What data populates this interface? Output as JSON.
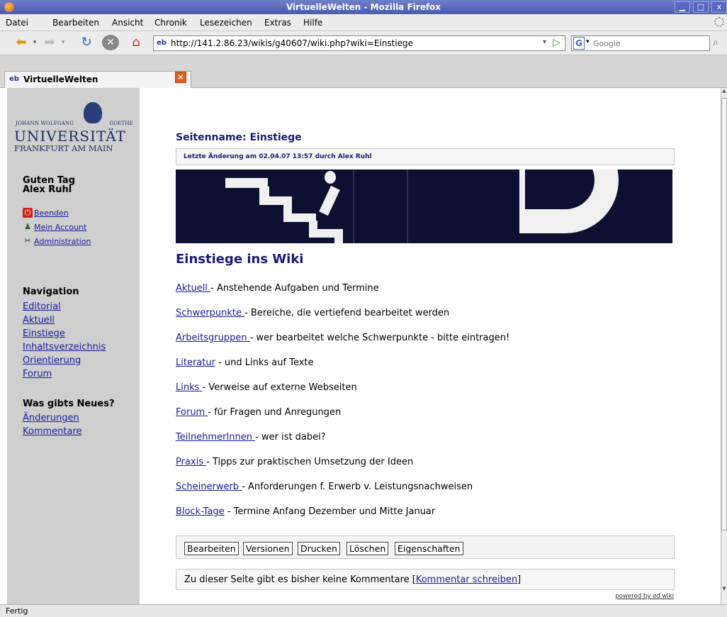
{
  "window": {
    "title": "VirtuelleWelten - Mozilla Firefox"
  },
  "menu": [
    "Datei",
    "Bearbeiten",
    "Ansicht",
    "Chronik",
    "Lesezeichen",
    "Extras",
    "Hilfe"
  ],
  "toolbar": {
    "url": "http://141.2.86.23/wikis/g40607/wiki.php?wiki=Einstiege",
    "search_placeholder": "Google"
  },
  "tab": {
    "label": "VirtuelleWelten",
    "favicon": "eb"
  },
  "logo": {
    "line1_left": "JOHANN WOLFGANG",
    "line1_right": "GOETHE",
    "line2": "UNIVERSITÄT",
    "line3": "FRANKFURT AM MAIN"
  },
  "sidebar": {
    "greeting_line1": "Guten Tag",
    "greeting_line2": "Alex Ruhl",
    "user_links": [
      {
        "label": "Beenden",
        "icon": "power-icon"
      },
      {
        "label": "Mein Account",
        "icon": "user-icon"
      },
      {
        "label": "Administration",
        "icon": "tools-icon"
      }
    ],
    "nav_heading": "Navigation",
    "nav_items": [
      "Editorial",
      "Aktuell",
      "Einstiege",
      "Inhaltsverzeichnis",
      "Orientierung",
      "Forum"
    ],
    "news_heading": "Was gibts Neues?",
    "news_items": [
      "Änderungen",
      "Kommentare"
    ]
  },
  "main": {
    "page_name": "Seitenname: Einstiege",
    "last_modified": "Letzte Änderung am 02.04.07 13:57 durch Alex Ruhl",
    "heading": "Einstiege ins Wiki",
    "entries": [
      {
        "link": "Aktuell ",
        "text": "- Anstehende Aufgaben und Termine"
      },
      {
        "link": "Schwerpunkte ",
        "text": "- Bereiche, die vertiefend bearbeitet werden"
      },
      {
        "link": "Arbeitsgruppen ",
        "text": "- wer bearbeitet welche Schwerpunkte - bitte eintragen!"
      },
      {
        "link": "Literatur",
        "text": " - und Links auf Texte"
      },
      {
        "link": "Links ",
        "text": "- Verweise auf externe Webseiten"
      },
      {
        "link": "Forum ",
        "text": "- für Fragen und Anregungen"
      },
      {
        "link": "TeilnehmerInnen ",
        "text": "- wer ist dabei?"
      },
      {
        "link": "Praxis ",
        "text": "- Tipps zur praktischen Umsetzung der Ideen"
      },
      {
        "link": "Scheinerwerb ",
        "text": "- Anforderungen f. Erwerb v. Leistungsnachweisen"
      },
      {
        "link": "Block-Tage",
        "text": " - Termine Anfang Dezember und Mitte Januar"
      }
    ],
    "actions": [
      "Bearbeiten",
      "Versionen",
      "Drucken",
      "Löschen",
      "Eigenschaften"
    ],
    "comment_prefix": "Zu dieser Seite gibt es bisher keine Kommentare [",
    "comment_link": "Kommentar schreiben",
    "comment_suffix": "]",
    "powered_by": "powered by ed.wiki"
  },
  "status": "Fertig"
}
